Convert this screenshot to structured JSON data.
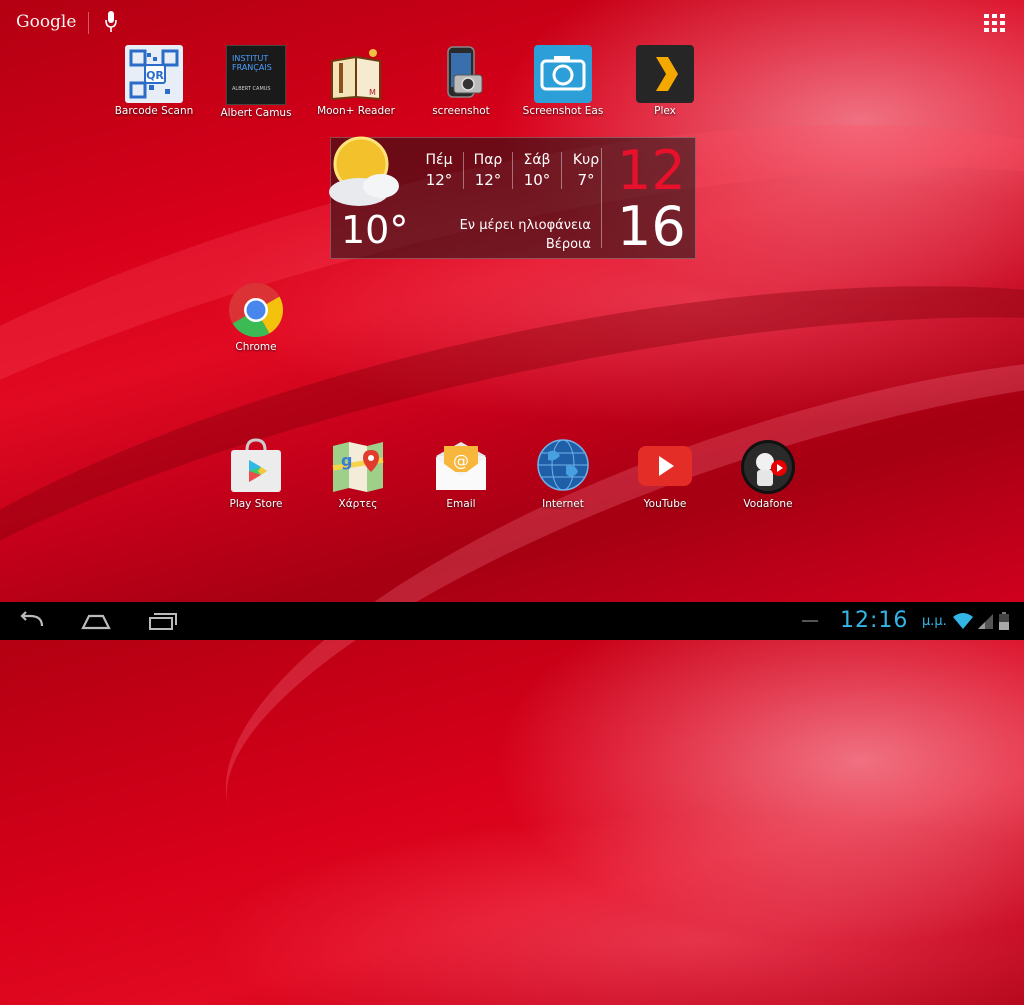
{
  "search": {
    "label": "Google"
  },
  "top_apps": [
    {
      "label": "Barcode Scann",
      "icon": "barcode-scanner-icon"
    },
    {
      "label": "Albert Camus",
      "icon": "albert-camus-icon"
    },
    {
      "label": "Moon+ Reader",
      "icon": "moon-reader-icon"
    },
    {
      "label": "screenshot",
      "icon": "screenshot-phone-icon"
    },
    {
      "label": "Screenshot Eas",
      "icon": "camera-icon"
    },
    {
      "label": "Plex",
      "icon": "plex-icon"
    }
  ],
  "albert_camus_logo": {
    "line1": "INSTITUT",
    "line2": "FRANÇAIS",
    "line3": "ALBERT CAMUS"
  },
  "weather": {
    "days": [
      {
        "day": "Πέμ",
        "temp": "12°"
      },
      {
        "day": "Παρ",
        "temp": "12°"
      },
      {
        "day": "Σάβ",
        "temp": "10°"
      },
      {
        "day": "Κυρ",
        "temp": "7°"
      }
    ],
    "current_temp": "10°",
    "condition": "Εν μέρει ηλιοφάνεια",
    "city": "Βέροια",
    "hour": "12",
    "minute": "16"
  },
  "middle_apps": [
    {
      "label": "Chrome",
      "icon": "chrome-icon"
    }
  ],
  "dock_apps": [
    {
      "label": "Play Store",
      "icon": "play-store-icon"
    },
    {
      "label": "Χάρτες",
      "icon": "maps-icon"
    },
    {
      "label": "Email",
      "icon": "email-icon"
    },
    {
      "label": "Internet",
      "icon": "globe-icon"
    },
    {
      "label": "YouTube",
      "icon": "youtube-icon"
    },
    {
      "label": "Vodafone",
      "icon": "vodafone-icon"
    }
  ],
  "status": {
    "time": "12:16",
    "ampm": "μ.μ."
  },
  "colors": {
    "accent": "#33b5e5",
    "clock_red": "#e8102a",
    "background": "#d8001a"
  }
}
